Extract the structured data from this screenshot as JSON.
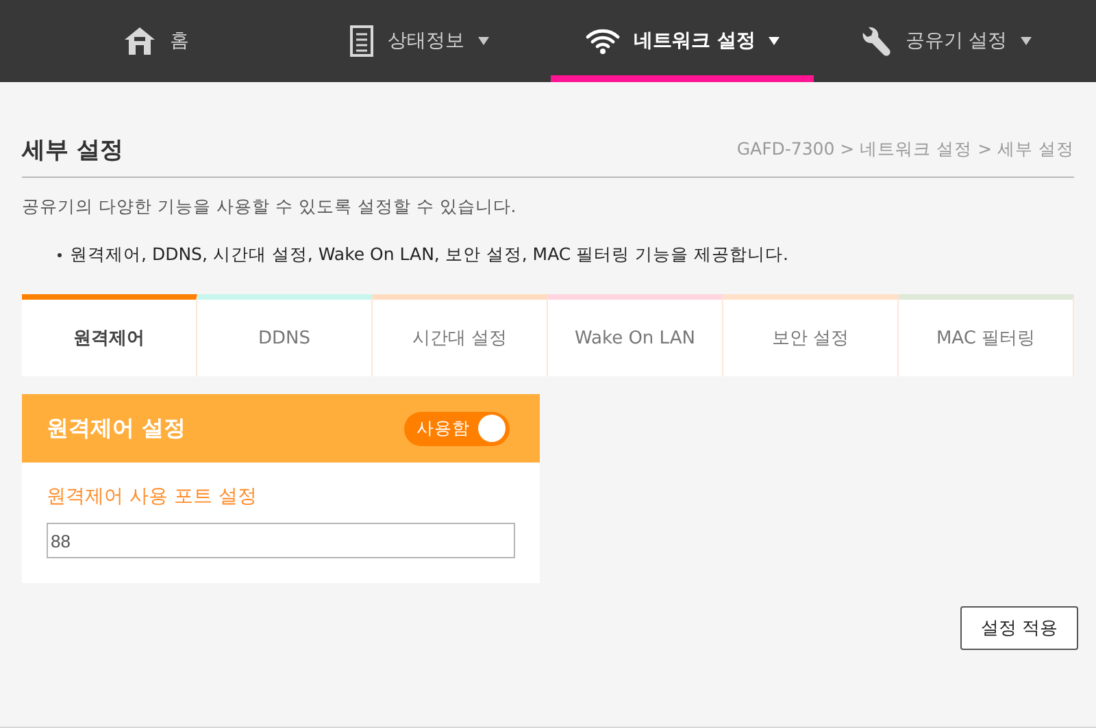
{
  "nav": [
    {
      "label": "홈",
      "dropdown": false,
      "selected": false
    },
    {
      "label": "상태정보",
      "dropdown": true,
      "selected": false
    },
    {
      "label": "네트워크 설정",
      "dropdown": true,
      "selected": true
    },
    {
      "label": "공유기 설정",
      "dropdown": true,
      "selected": false
    }
  ],
  "page": {
    "title": "세부 설정",
    "breadcrumb": "GAFD-7300 > 네트워크 설정 > 세부 설정",
    "description": "공유기의 다양한 기능을 사용할 수 있도록 설정할 수 있습니다.",
    "bullets": [
      "원격제어, DDNS, 시간대 설정, Wake On LAN, 보안 설정, MAC 필터링 기능을 제공합니다."
    ]
  },
  "tabs": [
    {
      "label": "원격제어",
      "color": "#ff7f00",
      "selected": true
    },
    {
      "label": "DDNS",
      "color": "#c8f5ec",
      "selected": false
    },
    {
      "label": "시간대 설정",
      "color": "#ffdcc0",
      "selected": false
    },
    {
      "label": "Wake On LAN",
      "color": "#ffd6e0",
      "selected": false
    },
    {
      "label": "보안 설정",
      "color": "#ffe0c8",
      "selected": false
    },
    {
      "label": "MAC 필터링",
      "color": "#e0e8d8",
      "selected": false
    }
  ],
  "panel": {
    "title": "원격제어 설정",
    "toggle": {
      "label": "사용함",
      "on": true
    },
    "field_label": "원격제어 사용 포트 설정",
    "field_value": "88"
  },
  "apply_button": "설정 적용"
}
